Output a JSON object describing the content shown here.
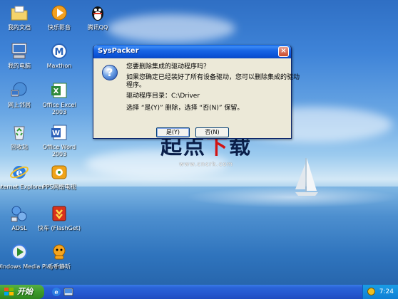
{
  "desktop": {
    "icons": [
      {
        "label": "我的文档",
        "icon": "folder-documents-icon"
      },
      {
        "label": "快乐影音",
        "icon": "media-player-icon"
      },
      {
        "label": "腾讯QQ",
        "icon": "qq-icon"
      },
      {
        "label": "我的电脑",
        "icon": "my-computer-icon"
      },
      {
        "label": "Maxthon",
        "icon": "maxthon-browser-icon"
      },
      {
        "label": "网上邻居",
        "icon": "network-icon"
      },
      {
        "label": "Office Excel 2003",
        "icon": "excel-icon"
      },
      {
        "label": "回收站",
        "icon": "recycle-bin-icon"
      },
      {
        "label": "Office Word 2003",
        "icon": "word-icon"
      },
      {
        "label": "Internet Explorer",
        "icon": "ie-icon"
      },
      {
        "label": "PPS网络电视",
        "icon": "pps-icon"
      },
      {
        "label": "ADSL",
        "icon": "adsl-icon"
      },
      {
        "label": "快车 (FlashGet)",
        "icon": "flashget-icon"
      },
      {
        "label": "Windows Media Player",
        "icon": "wmp-icon"
      },
      {
        "label": "千千静听",
        "icon": "ttplayer-icon"
      }
    ]
  },
  "watermark": {
    "text_main": "起点",
    "text_red": "下",
    "text_end": "载",
    "url": "www.cncrk.com"
  },
  "dialog": {
    "title": "SysPacker",
    "close_label": "×",
    "icon": "question-icon",
    "line1": "您要删除集成的驱动程序吗？",
    "line2": "如果您确定已经装好了所有设备驱动，您可以删除集成的驱动",
    "line3": "程序。",
    "line4": "驱动程序目录：C:\\Driver",
    "line5": "选择 “是(Y)” 删除，选择 “否(N)” 保留。",
    "yes_label": "是(Y)",
    "no_label": "否(N)"
  },
  "taskbar": {
    "start_label": "开始",
    "clock": "7:24"
  },
  "colors": {
    "titlebar": "#0a52d6",
    "start_button": "#3c9b2b",
    "taskbar": "#2558d0",
    "watermark_red": "#d21414"
  }
}
